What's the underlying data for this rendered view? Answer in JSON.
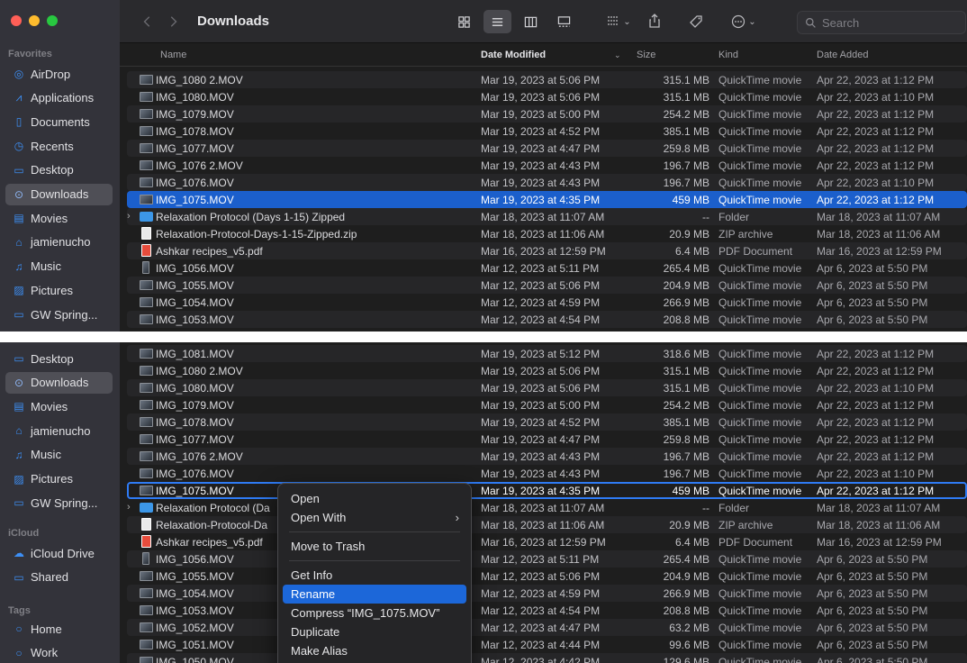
{
  "window1": {
    "title": "Downloads",
    "search_placeholder": "Search",
    "sidebar": {
      "favorites_heading": "Favorites",
      "items": [
        {
          "label": "AirDrop",
          "icon": "airdrop-icon",
          "glyph": "◎"
        },
        {
          "label": "Applications",
          "icon": "applications-icon",
          "glyph": "⩘"
        },
        {
          "label": "Documents",
          "icon": "document-icon",
          "glyph": "▯"
        },
        {
          "label": "Recents",
          "icon": "clock-icon",
          "glyph": "◷"
        },
        {
          "label": "Desktop",
          "icon": "desktop-icon",
          "glyph": "▭"
        },
        {
          "label": "Downloads",
          "icon": "downloads-icon",
          "glyph": "⊙",
          "selected": true
        },
        {
          "label": "Movies",
          "icon": "film-icon",
          "glyph": "▤"
        },
        {
          "label": "jamienucho",
          "icon": "home-icon",
          "glyph": "⌂"
        },
        {
          "label": "Music",
          "icon": "music-icon",
          "glyph": "♫"
        },
        {
          "label": "Pictures",
          "icon": "photo-icon",
          "glyph": "▨"
        },
        {
          "label": "GW Spring...",
          "icon": "folder-icon",
          "glyph": "▭"
        }
      ]
    },
    "columns": {
      "name": "Name",
      "date_modified": "Date Modified",
      "size": "Size",
      "kind": "Kind",
      "date_added": "Date Added"
    },
    "rows": [
      {
        "name": "IMG_1080 2.MOV",
        "date": "Mar 19, 2023 at 5:06 PM",
        "size": "315.1 MB",
        "kind": "QuickTime movie",
        "added": "Apr 22, 2023 at 1:12 PM",
        "icon": "mov"
      },
      {
        "name": "IMG_1080.MOV",
        "date": "Mar 19, 2023 at 5:06 PM",
        "size": "315.1 MB",
        "kind": "QuickTime movie",
        "added": "Apr 22, 2023 at 1:10 PM",
        "icon": "mov"
      },
      {
        "name": "IMG_1079.MOV",
        "date": "Mar 19, 2023 at 5:00 PM",
        "size": "254.2 MB",
        "kind": "QuickTime movie",
        "added": "Apr 22, 2023 at 1:12 PM",
        "icon": "mov"
      },
      {
        "name": "IMG_1078.MOV",
        "date": "Mar 19, 2023 at 4:52 PM",
        "size": "385.1 MB",
        "kind": "QuickTime movie",
        "added": "Apr 22, 2023 at 1:12 PM",
        "icon": "mov"
      },
      {
        "name": "IMG_1077.MOV",
        "date": "Mar 19, 2023 at 4:47 PM",
        "size": "259.8 MB",
        "kind": "QuickTime movie",
        "added": "Apr 22, 2023 at 1:12 PM",
        "icon": "mov"
      },
      {
        "name": "IMG_1076 2.MOV",
        "date": "Mar 19, 2023 at 4:43 PM",
        "size": "196.7 MB",
        "kind": "QuickTime movie",
        "added": "Apr 22, 2023 at 1:12 PM",
        "icon": "mov"
      },
      {
        "name": "IMG_1076.MOV",
        "date": "Mar 19, 2023 at 4:43 PM",
        "size": "196.7 MB",
        "kind": "QuickTime movie",
        "added": "Apr 22, 2023 at 1:10 PM",
        "icon": "mov"
      },
      {
        "name": "IMG_1075.MOV",
        "date": "Mar 19, 2023 at 4:35 PM",
        "size": "459 MB",
        "kind": "QuickTime movie",
        "added": "Apr 22, 2023 at 1:12 PM",
        "icon": "mov",
        "selected": true
      },
      {
        "name": "Relaxation Protocol (Days 1-15) Zipped",
        "date": "Mar 18, 2023 at 11:07 AM",
        "size": "--",
        "kind": "Folder",
        "added": "Mar 18, 2023 at 11:07 AM",
        "icon": "folder",
        "disclosure": "›"
      },
      {
        "name": "Relaxation-Protocol-Days-1-15-Zipped.zip",
        "date": "Mar 18, 2023 at 11:06 AM",
        "size": "20.9 MB",
        "kind": "ZIP archive",
        "added": "Mar 18, 2023 at 11:06 AM",
        "icon": "zip"
      },
      {
        "name": "Ashkar recipes_v5.pdf",
        "date": "Mar 16, 2023 at 12:59 PM",
        "size": "6.4 MB",
        "kind": "PDF Document",
        "added": "Mar 16, 2023 at 12:59 PM",
        "icon": "pdf"
      },
      {
        "name": "IMG_1056.MOV",
        "date": "Mar 12, 2023 at 5:11 PM",
        "size": "265.4 MB",
        "kind": "QuickTime movie",
        "added": "Apr 6, 2023 at 5:50 PM",
        "icon": "tall"
      },
      {
        "name": "IMG_1055.MOV",
        "date": "Mar 12, 2023 at 5:06 PM",
        "size": "204.9 MB",
        "kind": "QuickTime movie",
        "added": "Apr 6, 2023 at 5:50 PM",
        "icon": "mov"
      },
      {
        "name": "IMG_1054.MOV",
        "date": "Mar 12, 2023 at 4:59 PM",
        "size": "266.9 MB",
        "kind": "QuickTime movie",
        "added": "Apr 6, 2023 at 5:50 PM",
        "icon": "mov"
      },
      {
        "name": "IMG_1053.MOV",
        "date": "Mar 12, 2023 at 4:54 PM",
        "size": "208.8 MB",
        "kind": "QuickTime movie",
        "added": "Apr 6, 2023 at 5:50 PM",
        "icon": "mov"
      }
    ]
  },
  "window2": {
    "sidebar": {
      "items": [
        {
          "label": "Desktop",
          "icon": "desktop-icon",
          "glyph": "▭"
        },
        {
          "label": "Downloads",
          "icon": "downloads-icon",
          "glyph": "⊙",
          "selected": true
        },
        {
          "label": "Movies",
          "icon": "film-icon",
          "glyph": "▤"
        },
        {
          "label": "jamienucho",
          "icon": "home-icon",
          "glyph": "⌂"
        },
        {
          "label": "Music",
          "icon": "music-icon",
          "glyph": "♫"
        },
        {
          "label": "Pictures",
          "icon": "photo-icon",
          "glyph": "▨"
        },
        {
          "label": "GW Spring...",
          "icon": "folder-icon",
          "glyph": "▭"
        }
      ],
      "icloud_heading": "iCloud",
      "icloud_items": [
        {
          "label": "iCloud Drive",
          "icon": "cloud-icon",
          "glyph": "☁"
        },
        {
          "label": "Shared",
          "icon": "shared-folder-icon",
          "glyph": "▭"
        }
      ],
      "tags_heading": "Tags",
      "tag_items": [
        {
          "label": "Home",
          "icon": "tag-circle-icon",
          "glyph": "○"
        },
        {
          "label": "Work",
          "icon": "tag-circle-icon",
          "glyph": "○"
        }
      ]
    },
    "rows": [
      {
        "name": "IMG_1081.MOV",
        "date": "Mar 19, 2023 at 5:12 PM",
        "size": "318.6 MB",
        "kind": "QuickTime movie",
        "added": "Apr 22, 2023 at 1:12 PM",
        "icon": "mov"
      },
      {
        "name": "IMG_1080 2.MOV",
        "date": "Mar 19, 2023 at 5:06 PM",
        "size": "315.1 MB",
        "kind": "QuickTime movie",
        "added": "Apr 22, 2023 at 1:12 PM",
        "icon": "mov"
      },
      {
        "name": "IMG_1080.MOV",
        "date": "Mar 19, 2023 at 5:06 PM",
        "size": "315.1 MB",
        "kind": "QuickTime movie",
        "added": "Apr 22, 2023 at 1:10 PM",
        "icon": "mov"
      },
      {
        "name": "IMG_1079.MOV",
        "date": "Mar 19, 2023 at 5:00 PM",
        "size": "254.2 MB",
        "kind": "QuickTime movie",
        "added": "Apr 22, 2023 at 1:12 PM",
        "icon": "mov"
      },
      {
        "name": "IMG_1078.MOV",
        "date": "Mar 19, 2023 at 4:52 PM",
        "size": "385.1 MB",
        "kind": "QuickTime movie",
        "added": "Apr 22, 2023 at 1:12 PM",
        "icon": "mov"
      },
      {
        "name": "IMG_1077.MOV",
        "date": "Mar 19, 2023 at 4:47 PM",
        "size": "259.8 MB",
        "kind": "QuickTime movie",
        "added": "Apr 22, 2023 at 1:12 PM",
        "icon": "mov"
      },
      {
        "name": "IMG_1076 2.MOV",
        "date": "Mar 19, 2023 at 4:43 PM",
        "size": "196.7 MB",
        "kind": "QuickTime movie",
        "added": "Apr 22, 2023 at 1:12 PM",
        "icon": "mov"
      },
      {
        "name": "IMG_1076.MOV",
        "date": "Mar 19, 2023 at 4:43 PM",
        "size": "196.7 MB",
        "kind": "QuickTime movie",
        "added": "Apr 22, 2023 at 1:10 PM",
        "icon": "mov"
      },
      {
        "name": "IMG_1075.MOV",
        "date": "Mar 19, 2023 at 4:35 PM",
        "size": "459 MB",
        "kind": "QuickTime movie",
        "added": "Apr 22, 2023 at 1:12 PM",
        "icon": "mov",
        "selected": true
      },
      {
        "name": "Relaxation Protocol (Da",
        "date": "Mar 18, 2023 at 11:07 AM",
        "size": "--",
        "kind": "Folder",
        "added": "Mar 18, 2023 at 11:07 AM",
        "icon": "folder",
        "disclosure": "›"
      },
      {
        "name": "Relaxation-Protocol-Da",
        "date": "Mar 18, 2023 at 11:06 AM",
        "size": "20.9 MB",
        "kind": "ZIP archive",
        "added": "Mar 18, 2023 at 11:06 AM",
        "icon": "zip"
      },
      {
        "name": "Ashkar recipes_v5.pdf",
        "date": "Mar 16, 2023 at 12:59 PM",
        "size": "6.4 MB",
        "kind": "PDF Document",
        "added": "Mar 16, 2023 at 12:59 PM",
        "icon": "pdf"
      },
      {
        "name": "IMG_1056.MOV",
        "date": "Mar 12, 2023 at 5:11 PM",
        "size": "265.4 MB",
        "kind": "QuickTime movie",
        "added": "Apr 6, 2023 at 5:50 PM",
        "icon": "tall"
      },
      {
        "name": "IMG_1055.MOV",
        "date": "Mar 12, 2023 at 5:06 PM",
        "size": "204.9 MB",
        "kind": "QuickTime movie",
        "added": "Apr 6, 2023 at 5:50 PM",
        "icon": "mov"
      },
      {
        "name": "IMG_1054.MOV",
        "date": "Mar 12, 2023 at 4:59 PM",
        "size": "266.9 MB",
        "kind": "QuickTime movie",
        "added": "Apr 6, 2023 at 5:50 PM",
        "icon": "mov"
      },
      {
        "name": "IMG_1053.MOV",
        "date": "Mar 12, 2023 at 4:54 PM",
        "size": "208.8 MB",
        "kind": "QuickTime movie",
        "added": "Apr 6, 2023 at 5:50 PM",
        "icon": "mov"
      },
      {
        "name": "IMG_1052.MOV",
        "date": "Mar 12, 2023 at 4:47 PM",
        "size": "63.2 MB",
        "kind": "QuickTime movie",
        "added": "Apr 6, 2023 at 5:50 PM",
        "icon": "mov"
      },
      {
        "name": "IMG_1051.MOV",
        "date": "Mar 12, 2023 at 4:44 PM",
        "size": "99.6 MB",
        "kind": "QuickTime movie",
        "added": "Apr 6, 2023 at 5:50 PM",
        "icon": "mov"
      },
      {
        "name": "IMG_1050.MOV",
        "date": "Mar 12, 2023 at 4:42 PM",
        "size": "129.6 MB",
        "kind": "QuickTime movie",
        "added": "Apr 6, 2023 at 5:50 PM",
        "icon": "mov"
      }
    ],
    "context_menu": {
      "items": [
        {
          "label": "Open"
        },
        {
          "label": "Open With",
          "submenu": true,
          "arrow": "›"
        },
        {
          "separator": true
        },
        {
          "label": "Move to Trash"
        },
        {
          "separator": true
        },
        {
          "label": "Get Info"
        },
        {
          "label": "Rename",
          "highlighted": true
        },
        {
          "label": "Compress “IMG_1075.MOV”"
        },
        {
          "label": "Duplicate"
        },
        {
          "label": "Make Alias"
        }
      ]
    }
  },
  "colors": {
    "accent": "#1b5fcc",
    "sidebar_icon": "#3d8ff5",
    "close": "#ff5f57",
    "minimize": "#febc2e",
    "zoom": "#28c840",
    "menu_highlight": "#1c67d9"
  }
}
